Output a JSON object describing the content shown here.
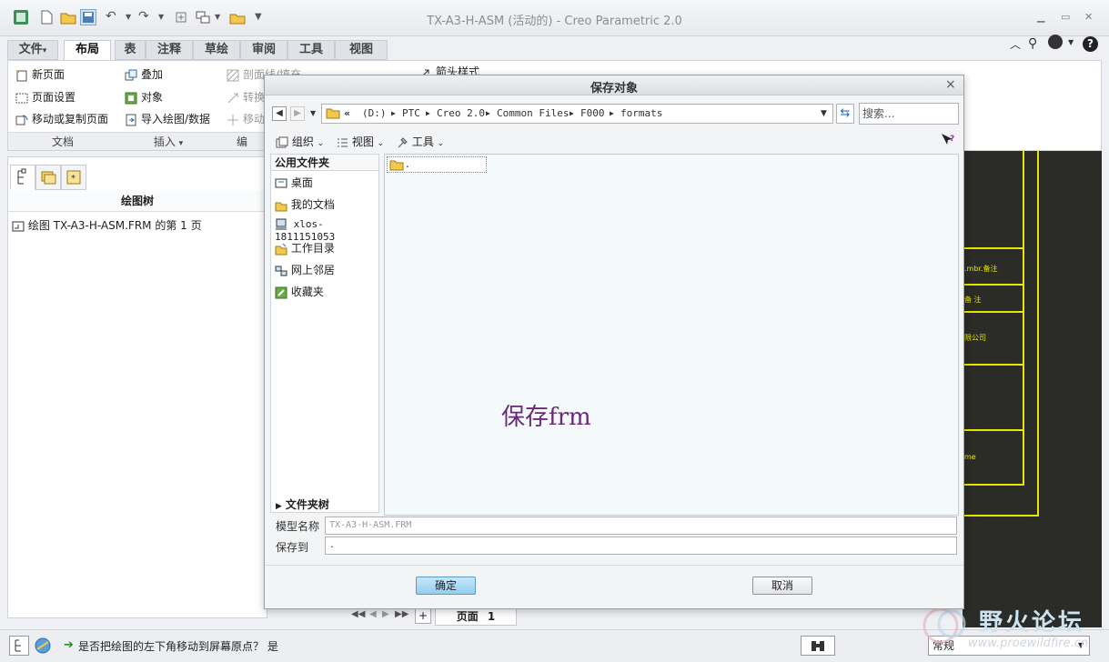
{
  "app": {
    "title": "TX-A3-H-ASM (活动的) - Creo Parametric 2.0"
  },
  "ribbon": {
    "tabs": [
      "文件",
      "布局",
      "表",
      "注释",
      "草绘",
      "审阅",
      "工具",
      "视图"
    ],
    "file_arrow": "▾",
    "doc_group": {
      "label": "文档",
      "items": [
        "新页面",
        "页面设置",
        "移动或复制页面"
      ]
    },
    "insert_group": {
      "label": "插入",
      "dropdown": "▾",
      "items": [
        "叠加",
        "对象",
        "导入绘图/数据"
      ]
    },
    "edit_group": {
      "label": "编",
      "items": [
        "剖面线/填充",
        "转换",
        "移动"
      ]
    },
    "arrow_style": "箭头样式"
  },
  "left_panel": {
    "tree_title": "绘图树",
    "tree_items": [
      "绘图 TX-A3-H-ASM.FRM 的第 1 页"
    ]
  },
  "graphics_labels": [
    ".mbr.备注",
    "备 注",
    "限公司",
    "me"
  ],
  "pagebar": {
    "add": "+",
    "page_label": "页面",
    "page_number": "1"
  },
  "status": {
    "message": "是否把绘图的左下角移动到屏幕原点？ 是",
    "mode": "常规"
  },
  "dialog": {
    "title": "保存对象",
    "breadcrumb": [
      "«",
      "(D:)",
      "PTC",
      "Creo 2.0",
      "Common Files",
      "F000",
      "formats"
    ],
    "search_placeholder": "搜索...",
    "toolbar": {
      "organize": "组织",
      "view": "视图",
      "tools": "工具"
    },
    "places_header": "公用文件夹",
    "places": [
      "桌面",
      "我的文档",
      "xlos-1811151053",
      "工作目录",
      "网上邻居",
      "收藏夹"
    ],
    "folder_tree": "文件夹树",
    "file_items": [
      "."
    ],
    "annotation": "保存frm",
    "model_name_label": "模型名称",
    "model_name_value": "TX-A3-H-ASM.FRM",
    "save_to_label": "保存到",
    "save_to_value": ".",
    "ok_label": "确定",
    "cancel_label": "取消",
    "close": "×"
  },
  "watermark": {
    "text": "野火论坛",
    "url_text": "www.proewildfire.cn"
  },
  "colors": {
    "accent_button": "#a8d8f0",
    "annotation": "#6a2a78",
    "graphics_bg": "#2b2b27",
    "frame_line": "#e6e600"
  }
}
